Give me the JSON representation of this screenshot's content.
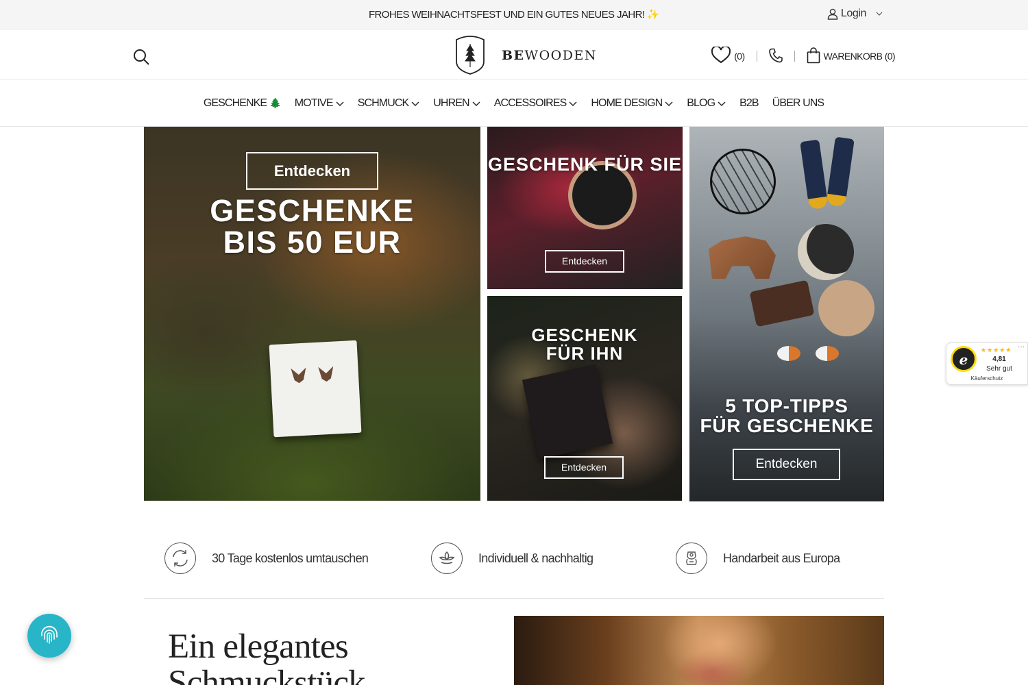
{
  "announcement": {
    "text": "FROHES WEIHNACHTSFEST UND EIN GUTES NEUES JAHR! ✨"
  },
  "account": {
    "login_label": "Login"
  },
  "header": {
    "brand_bold": "BE",
    "brand_rest": "WOODEN",
    "wishlist_count": "(0)",
    "cart_label": "WARENKORB (0)"
  },
  "nav": {
    "items": [
      {
        "label": "GESCHENKE",
        "icon": "tree-emoji",
        "dropdown": false
      },
      {
        "label": "MOTIVE",
        "dropdown": true
      },
      {
        "label": "SCHMUCK",
        "dropdown": true
      },
      {
        "label": "UHREN",
        "dropdown": true
      },
      {
        "label": "ACCESSOIRES",
        "dropdown": true
      },
      {
        "label": "HOME DESIGN",
        "dropdown": true
      },
      {
        "label": "BLOG",
        "dropdown": true
      },
      {
        "label": "B2B",
        "dropdown": false
      },
      {
        "label": "ÜBER UNS",
        "dropdown": false
      }
    ],
    "tree_glyph": "🌲"
  },
  "banners": {
    "gifts_under_50": {
      "title_line1": "GESCHENKE",
      "title_line2": "BIS 50 EUR",
      "button": "Entdecken"
    },
    "gift_for_her": {
      "title": "GESCHENK FÜR SIE",
      "button": "Entdecken"
    },
    "gift_for_him": {
      "title_line1": "GESCHENK",
      "title_line2": "FÜR IHN",
      "button": "Entdecken"
    },
    "top_tips": {
      "title_line1": "5 TOP-TIPPS",
      "title_line2": "FÜR GESCHENKE",
      "button": "Entdecken"
    }
  },
  "trusted_shops": {
    "seal_letter": "e",
    "stars": "★★★★★",
    "score": "4,81",
    "rating_text": "Sehr gut",
    "protection": "Käuferschutz",
    "more": "···"
  },
  "usps": [
    {
      "icon": "exchange-cycle-icon",
      "text": "30 Tage kostenlos umtauschen"
    },
    {
      "icon": "leaf-icon",
      "text": "Individuell & nachhaltig"
    },
    {
      "icon": "handmade-icon",
      "text": "Handarbeit aus Europa"
    }
  ],
  "section": {
    "headline_line1": "Ein elegantes",
    "headline_line2": "Schmuckstück"
  },
  "colors": {
    "chat_fab": "#28b5c7",
    "topbar_bg": "#f5f5f5",
    "rating_star": "#ffb400"
  }
}
